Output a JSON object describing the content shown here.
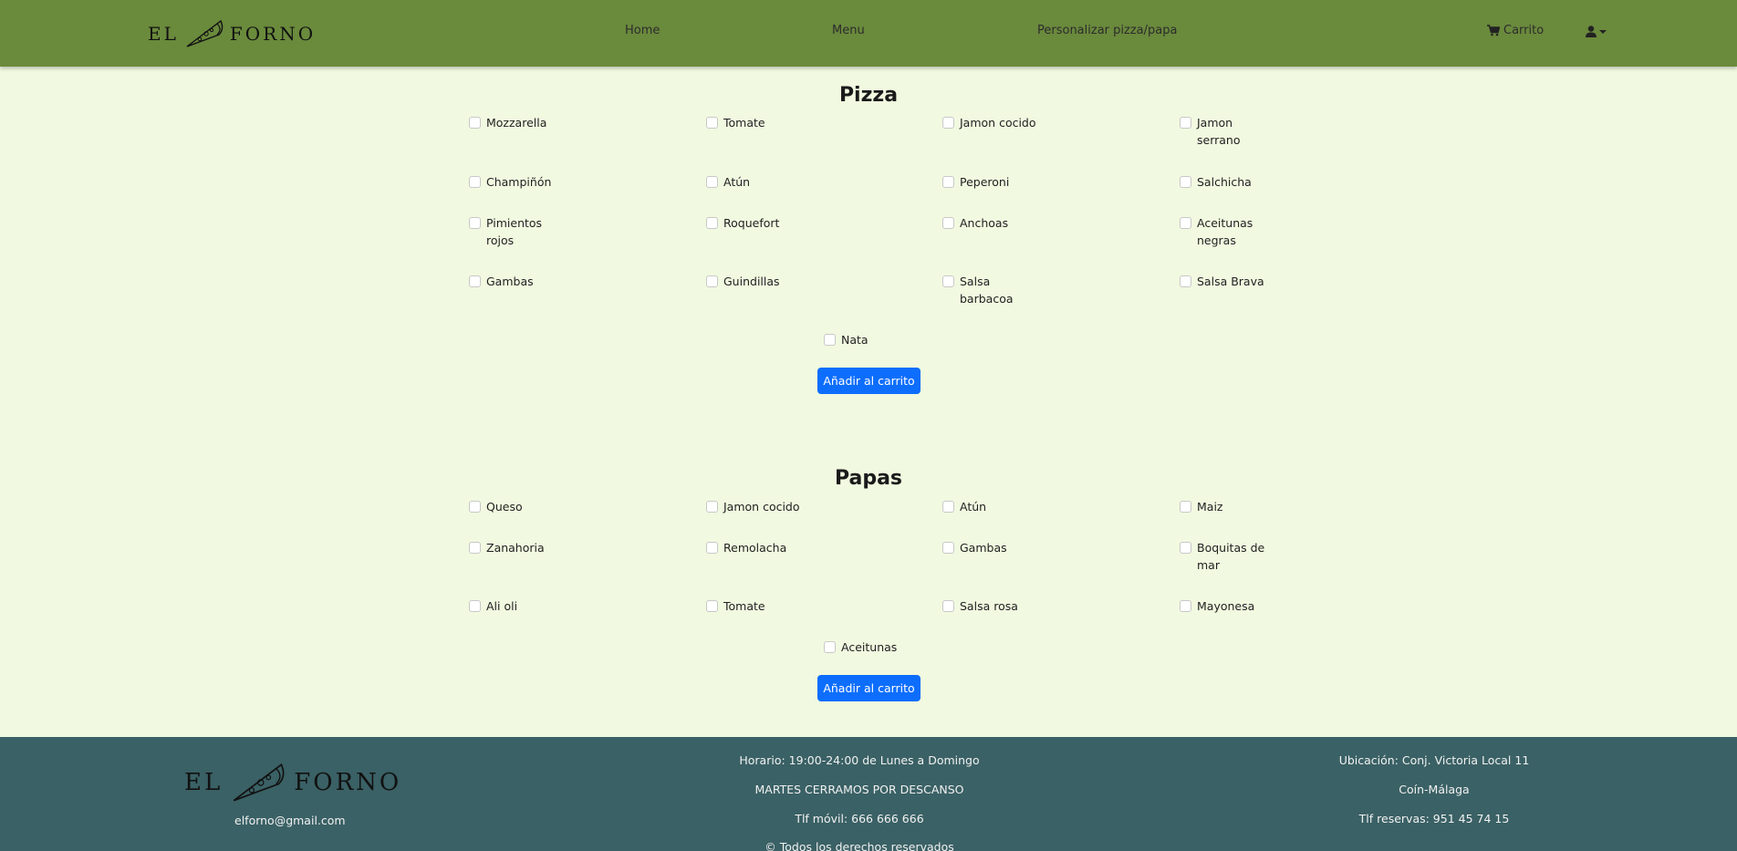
{
  "nav": {
    "logo_left": "EL",
    "logo_right": "FORNO",
    "links": [
      "Home",
      "Menu",
      "Personalizar pizza/papa"
    ],
    "cart_label": "Carrito"
  },
  "pizza": {
    "title": "Pizza",
    "options": [
      "Mozzarella",
      "Tomate",
      "Jamon cocido",
      "Jamon serrano",
      "Champiñón",
      "Atún",
      "Peperoni",
      "Salchicha",
      "Pimientos rojos",
      "Roquefort",
      "Anchoas",
      "Aceitunas negras",
      "Gambas",
      "Guindillas",
      "Salsa barbacoa",
      "Salsa Brava",
      "Nata"
    ],
    "button": "Añadir al carrito"
  },
  "papas": {
    "title": "Papas",
    "options": [
      "Queso",
      "Jamon cocido",
      "Atún",
      "Maiz",
      "Zanahoria",
      "Remolacha",
      "Gambas",
      "Boquitas de mar",
      "Ali oli",
      "Tomate",
      "Salsa rosa",
      "Mayonesa",
      "Aceitunas"
    ],
    "button": "Añadir al carrito"
  },
  "footer": {
    "logo_left": "EL",
    "logo_right": "FORNO",
    "email": "elforno@gmail.com",
    "schedule": "Horario: 19:00-24:00 de Lunes a Domingo",
    "closed_note": "MARTES CERRAMOS POR DESCANSO",
    "mobile": "Tlf móvil: 666 666 666",
    "rights": "© Todos los derechos reservados",
    "location": "Ubicación: Conj. Victoria Local 11",
    "city": "Coín-Málaga",
    "reservations": "Tlf reservas: 951 45 74 15"
  },
  "colors": {
    "navbar": "#6a8a3c",
    "page_background": "#f1f9e0",
    "button": "#0d6efd",
    "footer": "#3a6165"
  }
}
